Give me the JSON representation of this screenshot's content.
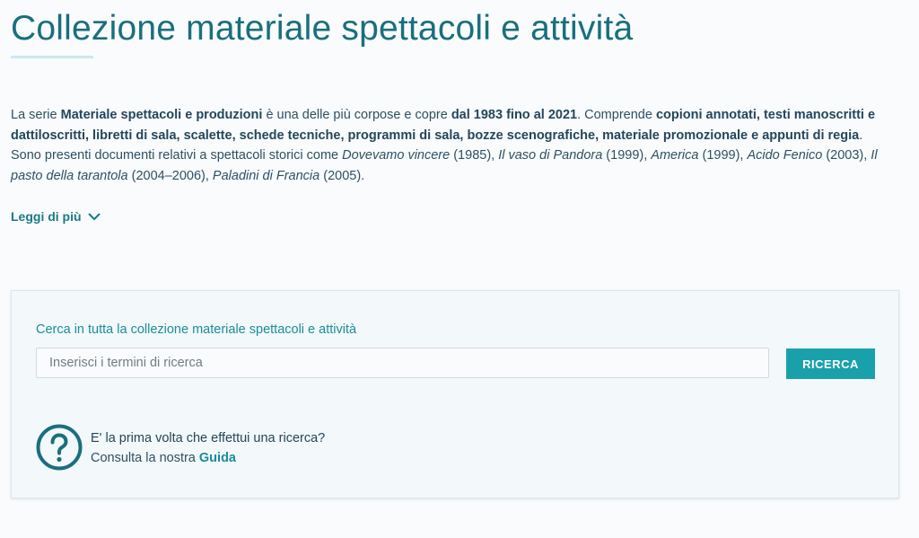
{
  "page": {
    "title": "Collezione materiale spettacoli e attività"
  },
  "intro": {
    "s1_a": "La serie ",
    "s1_b": "Materiale spettacoli e produzioni",
    "s1_c": " è una delle più corpose e copre ",
    "s1_d": "dal 1983 fino al 2021",
    "s1_e": ". Comprende ",
    "s1_f": "copioni annotati, testi manoscritti e dattiloscritti, libretti di sala, scalette, schede tecniche, programmi di sala, bozze scenografiche, materiale promozionale e appunti di regia",
    "s1_g": ".",
    "s2_a": "Sono presenti documenti relativi a spettacoli storici come ",
    "show1": "Dovevamo vincere",
    "year1": " (1985), ",
    "show2": "Il vaso di Pandora",
    "year2": " (1999), ",
    "show3": "America",
    "year3": " (1999), ",
    "show4": "Acido Fenico",
    "year4": " (2003), ",
    "show5": "Il pasto della tarantola",
    "year5": " (2004–2006), ",
    "show6": "Paladini di Francia",
    "year6": " (2005)."
  },
  "read_more": {
    "label": "Leggi di più",
    "icon": "chevron-down-icon"
  },
  "search": {
    "label": "Cerca in tutta la collezione materiale spettacoli e attività",
    "placeholder": "Inserisci i termini di ricerca",
    "value": "",
    "button_label": "RICERCA"
  },
  "help": {
    "icon": "question-circle-icon",
    "question": "E' la prima volta che effettui una ricerca?",
    "line_prefix": "Consulta la nostra ",
    "link_label": "Guida"
  },
  "colors": {
    "accent": "#1aa0ab",
    "title": "#1a6f7c",
    "text": "#2f4f62",
    "background": "#f9fbfd"
  }
}
